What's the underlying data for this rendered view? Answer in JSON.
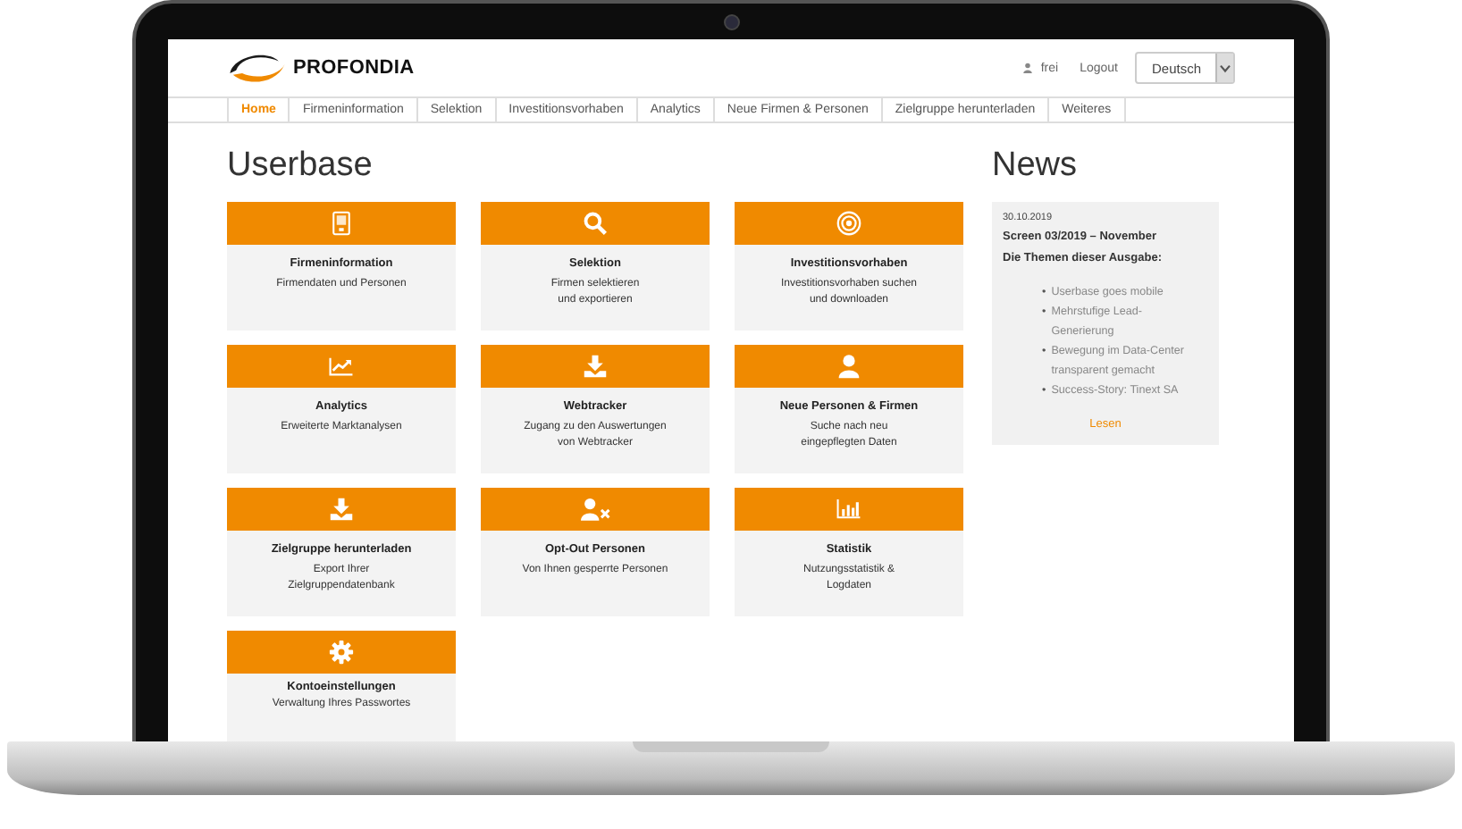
{
  "header": {
    "logo_text": "PROFONDIA",
    "user": "frei",
    "logout": "Logout",
    "language": "Deutsch"
  },
  "nav": [
    {
      "label": "Home",
      "selected": true
    },
    {
      "label": "Firmeninformation",
      "selected": false
    },
    {
      "label": "Selektion",
      "selected": false
    },
    {
      "label": "Investitionsvorhaben",
      "selected": false
    },
    {
      "label": "Analytics",
      "selected": false
    },
    {
      "label": "Neue Firmen & Personen",
      "selected": false
    },
    {
      "label": "Zielgruppe herunterladen",
      "selected": false
    },
    {
      "label": "Weiteres",
      "selected": false
    }
  ],
  "page_title": "Userbase",
  "tiles": [
    {
      "kind": "building",
      "title": "Firmeninformation",
      "description": [
        "Firmendaten und Personen"
      ]
    },
    {
      "kind": "search",
      "title": "Selektion",
      "description": [
        "Firmen selektieren",
        "und exportieren"
      ]
    },
    {
      "kind": "target",
      "title": "Investitionsvorhaben",
      "description": [
        "Investitionsvorhaben suchen",
        "und downloaden"
      ]
    },
    {
      "kind": "chart",
      "title": "Analytics",
      "description": [
        "Erweiterte Marktanalysen"
      ]
    },
    {
      "kind": "download",
      "title": "Webtracker",
      "description": [
        "Zugang zu den Auswertungen",
        "von Webtracker"
      ]
    },
    {
      "kind": "person",
      "title": "Neue Personen & Firmen",
      "description": [
        "Suche nach neu",
        "eingepflegten Daten"
      ]
    },
    {
      "kind": "download",
      "title": "Zielgruppe herunterladen",
      "description": [
        "Export Ihrer",
        "Zielgruppendatenbank"
      ]
    },
    {
      "kind": "personx",
      "title": "Opt-Out Personen",
      "description": [
        "Von Ihnen gesperrte Personen"
      ]
    },
    {
      "kind": "bars",
      "title": "Statistik",
      "description": [
        "Nutzungsstatistik &",
        "Logdaten"
      ]
    },
    {
      "kind": "gear",
      "title": "Kontoeinstellungen",
      "description": [
        "Verwaltung Ihres Passwortes"
      ]
    }
  ],
  "news": {
    "heading": "News",
    "date": "30.10.2019",
    "title": "Screen 03/2019 – November",
    "subtitle": "Die Themen dieser Ausgabe:",
    "items": [
      {
        "bullet": "•",
        "text": "Userbase goes mobile"
      },
      {
        "bullet": "•",
        "text": "Mehrstufige Lead-Generierung"
      },
      {
        "bullet": "•",
        "text": "Bewegung im Data-Center transparent gemacht"
      },
      {
        "bullet": "•",
        "text": "Success-Story: Tinext SA"
      }
    ],
    "link": "Lesen"
  }
}
